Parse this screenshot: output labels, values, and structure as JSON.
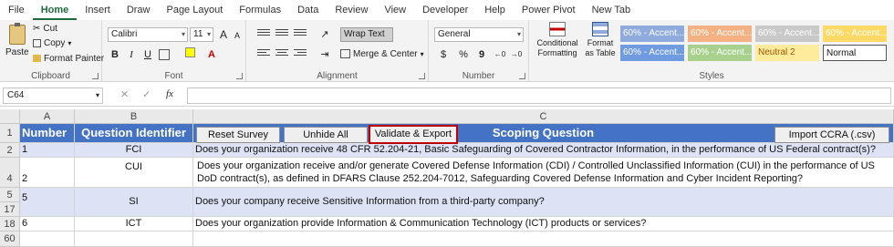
{
  "menu": {
    "tabs": [
      "File",
      "Home",
      "Insert",
      "Draw",
      "Page Layout",
      "Formulas",
      "Data",
      "Review",
      "View",
      "Developer",
      "Help",
      "Power Pivot",
      "New Tab"
    ],
    "active": "Home"
  },
  "ribbon": {
    "clipboard": {
      "paste": "Paste",
      "cut": "Cut",
      "copy": "Copy",
      "format_painter": "Format Painter",
      "label": "Clipboard"
    },
    "font": {
      "name": "Calibri",
      "size": "11",
      "label": "Font",
      "bold": "B",
      "italic": "I",
      "underline": "U",
      "grow": "A",
      "shrink": "A"
    },
    "alignment": {
      "wrap_text": "Wrap Text",
      "merge_center": "Merge & Center",
      "label": "Alignment"
    },
    "number": {
      "format": "General",
      "label": "Number",
      "currency": "$",
      "percent": "%",
      "comma": "9"
    },
    "styles": {
      "conditional": "Conditional Formatting",
      "format_table": "Format as Table",
      "label": "Styles",
      "cells": [
        {
          "text": "60% - Accent...",
          "color": "#8faadc"
        },
        {
          "text": "60% - Accent...",
          "color": "#f4b183"
        },
        {
          "text": "60% - Accent...",
          "color": "#c9c9c9"
        },
        {
          "text": "60% - Accent...",
          "color": "#ffd966"
        },
        {
          "text": "60% - Accent...",
          "color": "#6f9be0"
        },
        {
          "text": "60% - Accent...",
          "color": "#a9d18e"
        },
        {
          "text": "Neutral 2",
          "color": "#ffeb9c"
        },
        {
          "text": "Normal",
          "color": "#ffffff"
        }
      ]
    }
  },
  "formula_bar": {
    "cell_ref": "C64",
    "fx": "fx",
    "cancel": "✕",
    "enter": "✓"
  },
  "grid": {
    "columns": [
      "A",
      "B",
      "C"
    ],
    "row_numbers": [
      "1",
      "2",
      "4",
      "5",
      "17",
      "18",
      "60"
    ],
    "header": {
      "number": "Number",
      "question_identifier": "Question Identifier",
      "scoping_question": "Scoping Question"
    },
    "buttons": {
      "reset": "Reset Survey",
      "unhide": "Unhide All",
      "validate": "Validate & Export",
      "import": "Import CCRA (.csv)"
    },
    "rows": [
      {
        "number": "1",
        "id": "FCI",
        "question": "Does your organization receive 48 CFR 52.204-21, Basic Safeguarding of Covered Contractor Information, in the performance of US Federal contract(s)?"
      },
      {
        "number": "2",
        "id": "CUI",
        "question": "Does your organization receive and/or generate Covered Defense Information (CDI) / Controlled Unclassified Information (CUI) in the performance of US DoD contract(s), as defined in DFARS Clause 252.204-7012, Safeguarding Covered Defense Information and Cyber Incident Reporting?"
      },
      {
        "number": "5",
        "id": "SI",
        "question": "Does your company receive Sensitive Information from a third-party company?"
      },
      {
        "number": "6",
        "id": "ICT",
        "question": "Does your organization provide Information & Communication Technology (ICT) products or services?"
      }
    ]
  }
}
